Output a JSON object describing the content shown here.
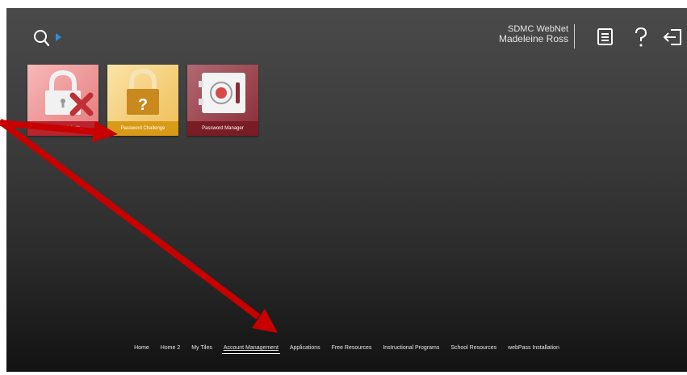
{
  "header": {
    "app_name": "SDMC WebNet",
    "user_name": "Madeleine Ross",
    "icons": [
      "search-icon",
      "list-icon",
      "help-icon",
      "sign-out-icon"
    ]
  },
  "tiles": [
    {
      "label": "Account Unlock",
      "icon": "lock-x-icon",
      "color": "#b8232d"
    },
    {
      "label": "Password Challenge",
      "icon": "lock-question-icon",
      "color": "#d99a17"
    },
    {
      "label": "Password Manager",
      "icon": "safe-icon",
      "color": "#7a1c25"
    }
  ],
  "nav": {
    "items": [
      "Home",
      "Home 2",
      "My Tiles",
      "Account Management",
      "Applications",
      "Free Resources",
      "Instructional Programs",
      "School Resources",
      "webPass Installation"
    ],
    "active": "Account Management"
  },
  "colors": {
    "accent_blue": "#2e8fd9",
    "annotation_arrow": "#c80000"
  }
}
